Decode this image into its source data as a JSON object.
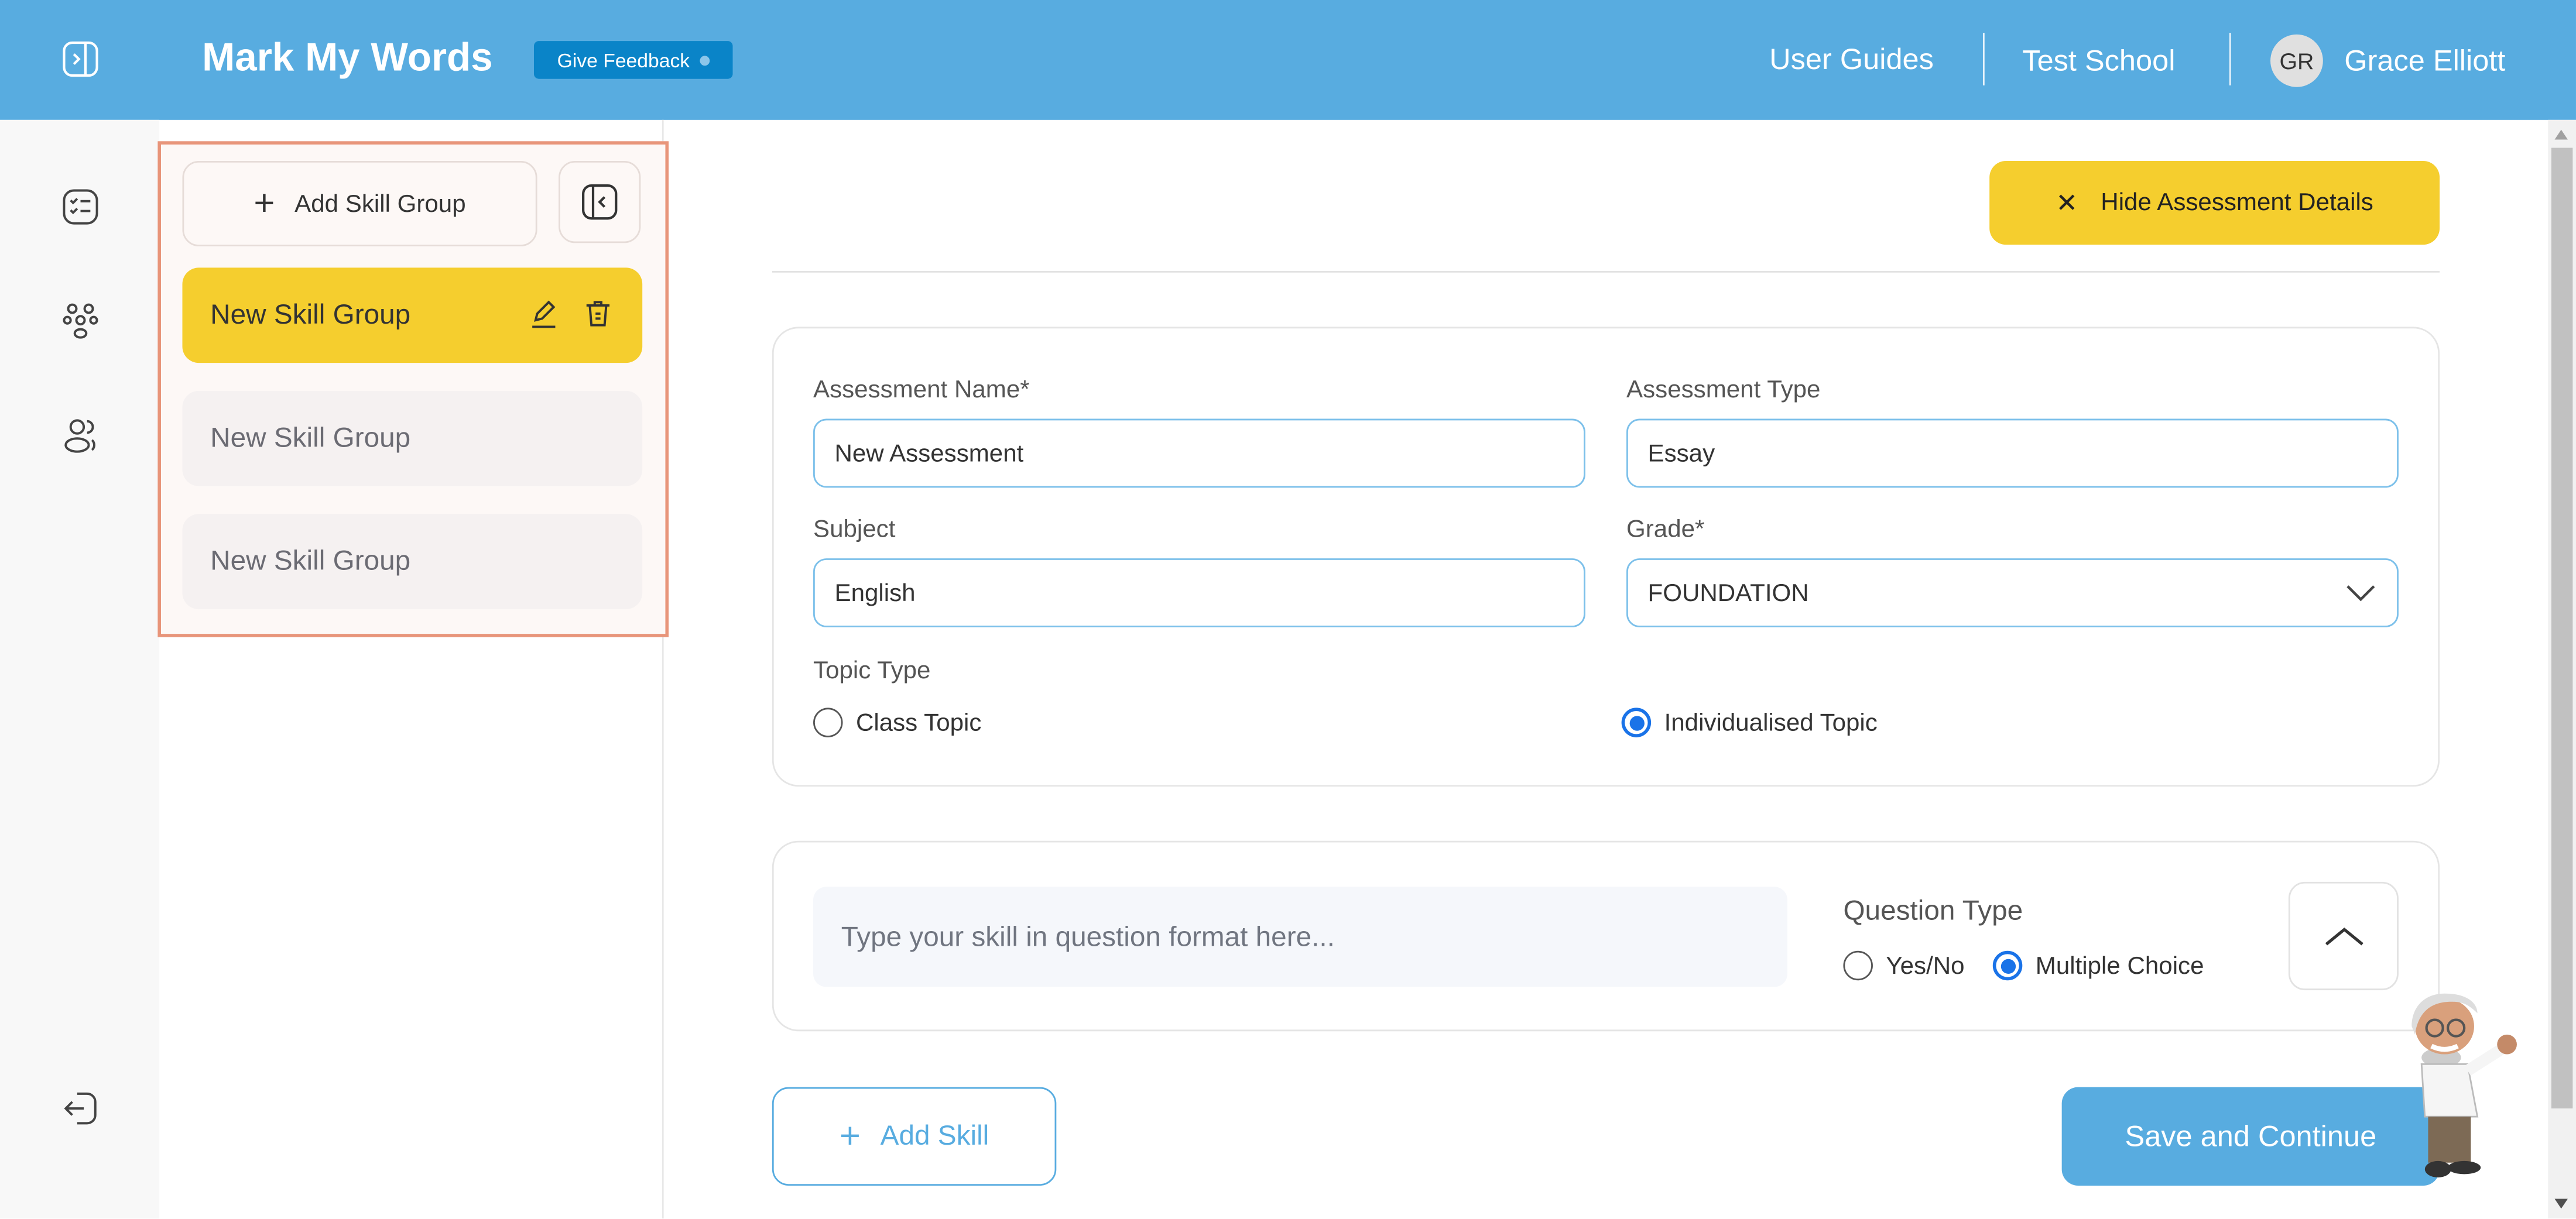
{
  "header": {
    "app_title": "Mark My Words",
    "feedback_label": "Give Feedback",
    "user_guides": "User Guides",
    "school": "Test School",
    "avatar_initials": "GR",
    "user_name": "Grace Elliott",
    "color": "#58ACE0"
  },
  "rail": {
    "icons": [
      "assessment-list-icon",
      "groups-icon",
      "users-icon",
      "logout-icon"
    ]
  },
  "skill_groups": {
    "add_label": "Add Skill Group",
    "items": [
      {
        "label": "New Skill Group",
        "active": true
      },
      {
        "label": "New Skill Group",
        "active": false
      },
      {
        "label": "New Skill Group",
        "active": false
      }
    ]
  },
  "main": {
    "hide_details_label": "Hide Assessment Details",
    "form": {
      "name_label": "Assessment Name*",
      "name_value": "New Assessment",
      "type_label": "Assessment Type",
      "type_value": "Essay",
      "subject_label": "Subject",
      "subject_value": "English",
      "grade_label": "Grade*",
      "grade_value": "FOUNDATION",
      "topic_type_label": "Topic Type",
      "topic_options": [
        "Class Topic",
        "Individualised Topic"
      ],
      "topic_selected": "Individualised Topic"
    },
    "skill": {
      "placeholder": "Type your skill in question format here...",
      "question_type_label": "Question Type",
      "options": [
        "Yes/No",
        "Multiple Choice"
      ],
      "selected": "Multiple Choice"
    },
    "add_skill_label": "Add Skill",
    "save_label": "Save and Continue"
  },
  "colors": {
    "accent_yellow": "#F5CE2E",
    "primary_blue": "#58ACE0",
    "feedback_blue": "#0A84C8",
    "highlight_border": "#E8957A"
  }
}
